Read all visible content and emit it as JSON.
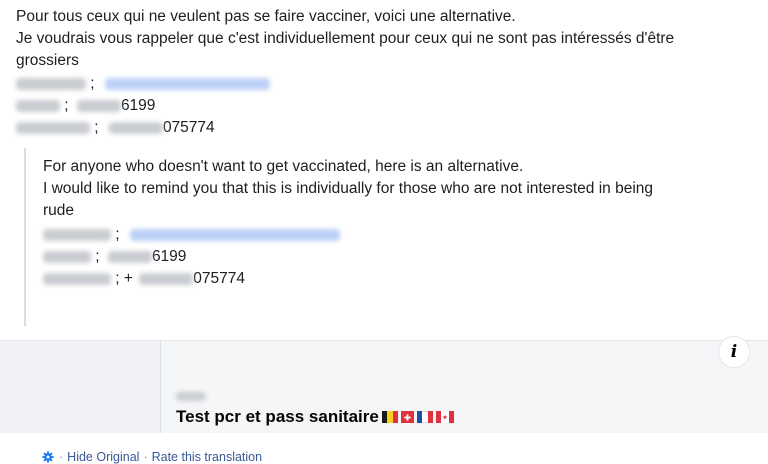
{
  "post": {
    "fr_line1": "Pour tous ceux qui ne veulent pas se faire vacciner, voici une alternative.",
    "fr_line2": "Je voudrais vous rappeler que c'est individuellement pour ceux qui ne sont pas intéressés d'être",
    "fr_line3": "grossiers",
    "fr_contacts": [
      {
        "sep": " ;",
        "value": ""
      },
      {
        "sep": " ;",
        "value": "6199"
      },
      {
        "sep": " ;",
        "value": "075774"
      }
    ]
  },
  "translation": {
    "line1": "For anyone who doesn't want to get vaccinated, here is an alternative.",
    "line2": "I would like to remind you that this is individually for those who are not interested in being",
    "line3": "rude",
    "contacts": [
      {
        "sep": " ;",
        "value": ""
      },
      {
        "sep": " ;",
        "value": "6199"
      },
      {
        "sep": " ; +",
        "value": "075774"
      }
    ],
    "hide_original": "Hide Original",
    "rate": "Rate this translation",
    "separator": "·"
  },
  "card": {
    "title": "Test pcr et pass sanitaire",
    "info_icon": "i"
  },
  "colors": {
    "link": "#385898",
    "background": "#f0f2f5"
  },
  "icons": [
    "gear-icon",
    "info-icon",
    "flag-belgium-icon",
    "flag-switzerland-icon",
    "flag-france-icon",
    "flag-canada-icon"
  ]
}
